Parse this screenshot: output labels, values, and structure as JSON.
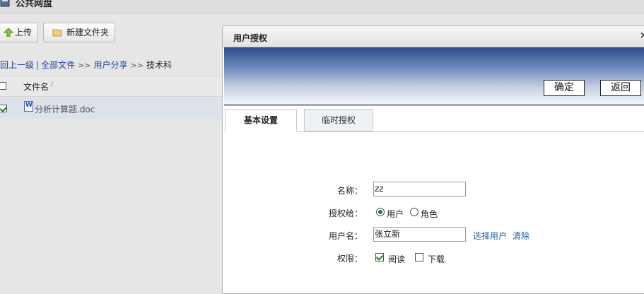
{
  "window": {
    "title": "公共网盘"
  },
  "toolbar": {
    "upload": "上传",
    "new_folder": "新建文件夹"
  },
  "breadcrumb": {
    "up": "回上一级",
    "all": "全部文件",
    "share": "用户分享",
    "current": "技术科",
    "sep": "|",
    "arrow": ">>"
  },
  "file_list": {
    "header": "文件名",
    "rows": [
      {
        "name": "分析计算题.doc",
        "checked": true
      }
    ]
  },
  "dialog": {
    "title": "用户授权",
    "close": "×",
    "confirm": "确定",
    "back": "返回",
    "tabs": [
      {
        "label": "基本设置",
        "active": true
      },
      {
        "label": "临时授权",
        "active": false
      }
    ],
    "form": {
      "name_label": "名称：",
      "name_value": "zz",
      "grant_label": "授权给：",
      "grant_user": "用户",
      "grant_role": "角色",
      "user_label": "用户名：",
      "user_value": "张立新",
      "select_user": "选择用户",
      "clear": "清除",
      "perm_label": "权限：",
      "perm_read": "阅读",
      "perm_download": "下载"
    }
  }
}
